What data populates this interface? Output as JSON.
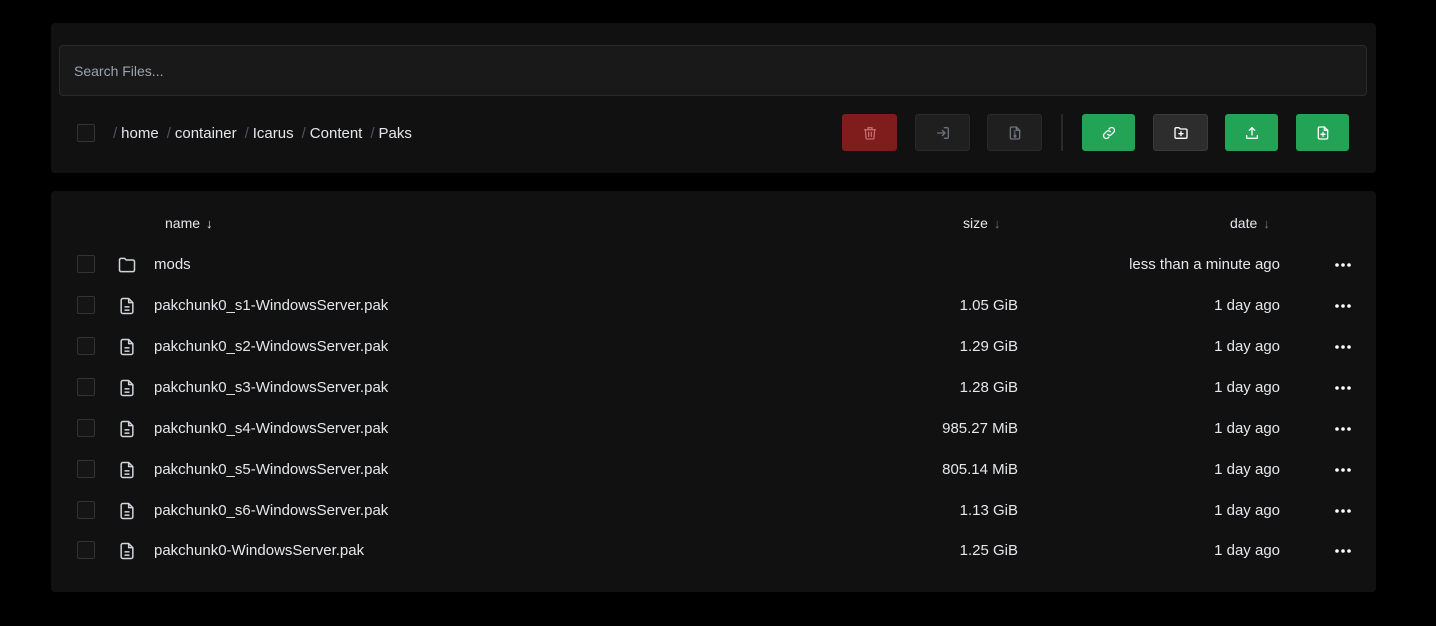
{
  "search": {
    "placeholder": "Search Files..."
  },
  "breadcrumb": {
    "separator": "/",
    "items": [
      "home",
      "container",
      "Icarus",
      "Content",
      "Paks"
    ]
  },
  "toolbar": {
    "buttons": [
      {
        "icon": "trash-icon",
        "color": "#7f1d1d"
      },
      {
        "icon": "move-icon",
        "color": "#1f1f1f"
      },
      {
        "icon": "archive-icon",
        "color": "#1f1f1f"
      },
      {
        "icon": "link-icon",
        "color": "#22a355"
      },
      {
        "icon": "new-folder-icon",
        "color": "#2d2d2d"
      },
      {
        "icon": "upload-icon",
        "color": "#22a355"
      },
      {
        "icon": "new-file-icon",
        "color": "#22a355"
      }
    ]
  },
  "columns": {
    "name": "name",
    "size": "size",
    "date": "date",
    "sort_arrow": "↓"
  },
  "files": [
    {
      "type": "folder",
      "name": "mods",
      "size": "",
      "date": "less than a minute ago"
    },
    {
      "type": "file",
      "name": "pakchunk0_s1-WindowsServer.pak",
      "size": "1.05 GiB",
      "date": "1 day ago"
    },
    {
      "type": "file",
      "name": "pakchunk0_s2-WindowsServer.pak",
      "size": "1.29 GiB",
      "date": "1 day ago"
    },
    {
      "type": "file",
      "name": "pakchunk0_s3-WindowsServer.pak",
      "size": "1.28 GiB",
      "date": "1 day ago"
    },
    {
      "type": "file",
      "name": "pakchunk0_s4-WindowsServer.pak",
      "size": "985.27 MiB",
      "date": "1 day ago"
    },
    {
      "type": "file",
      "name": "pakchunk0_s5-WindowsServer.pak",
      "size": "805.14 MiB",
      "date": "1 day ago"
    },
    {
      "type": "file",
      "name": "pakchunk0_s6-WindowsServer.pak",
      "size": "1.13 GiB",
      "date": "1 day ago"
    },
    {
      "type": "file",
      "name": "pakchunk0-WindowsServer.pak",
      "size": "1.25 GiB",
      "date": "1 day ago"
    }
  ]
}
